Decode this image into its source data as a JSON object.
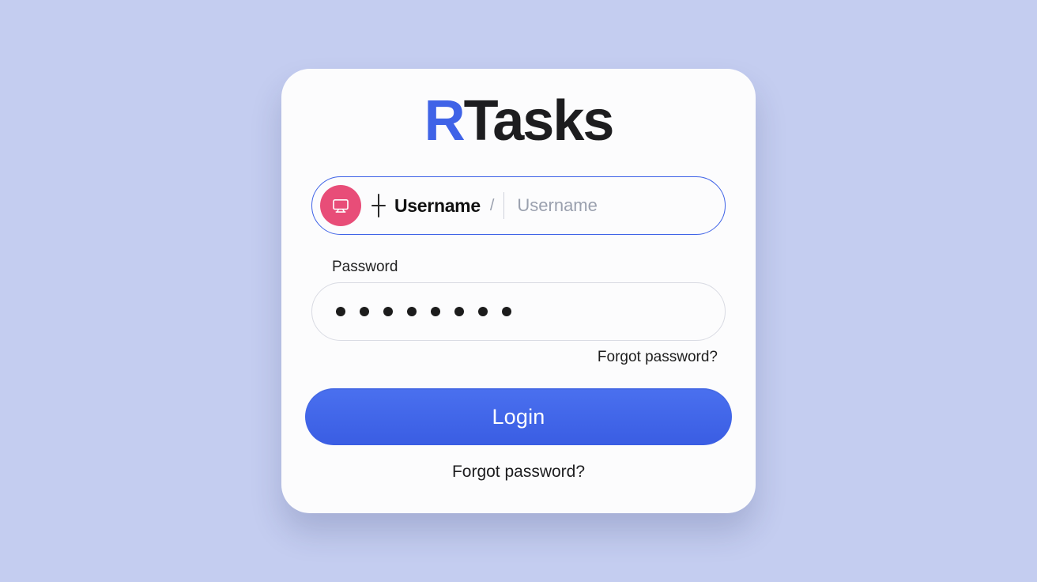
{
  "brand": {
    "prefix": "R",
    "name": "Tasks"
  },
  "username": {
    "label": "Username",
    "separator": "/",
    "placeholder": "Username",
    "value": ""
  },
  "password": {
    "label": "Password",
    "value": "••••••••",
    "dot_count": 8
  },
  "links": {
    "forgot_inline": "Forgot password?",
    "forgot_center": "Forgot password?"
  },
  "buttons": {
    "login": "Login"
  },
  "colors": {
    "background": "#c4cdf0",
    "accent": "#3f63e7",
    "avatar": "#e84d78"
  }
}
